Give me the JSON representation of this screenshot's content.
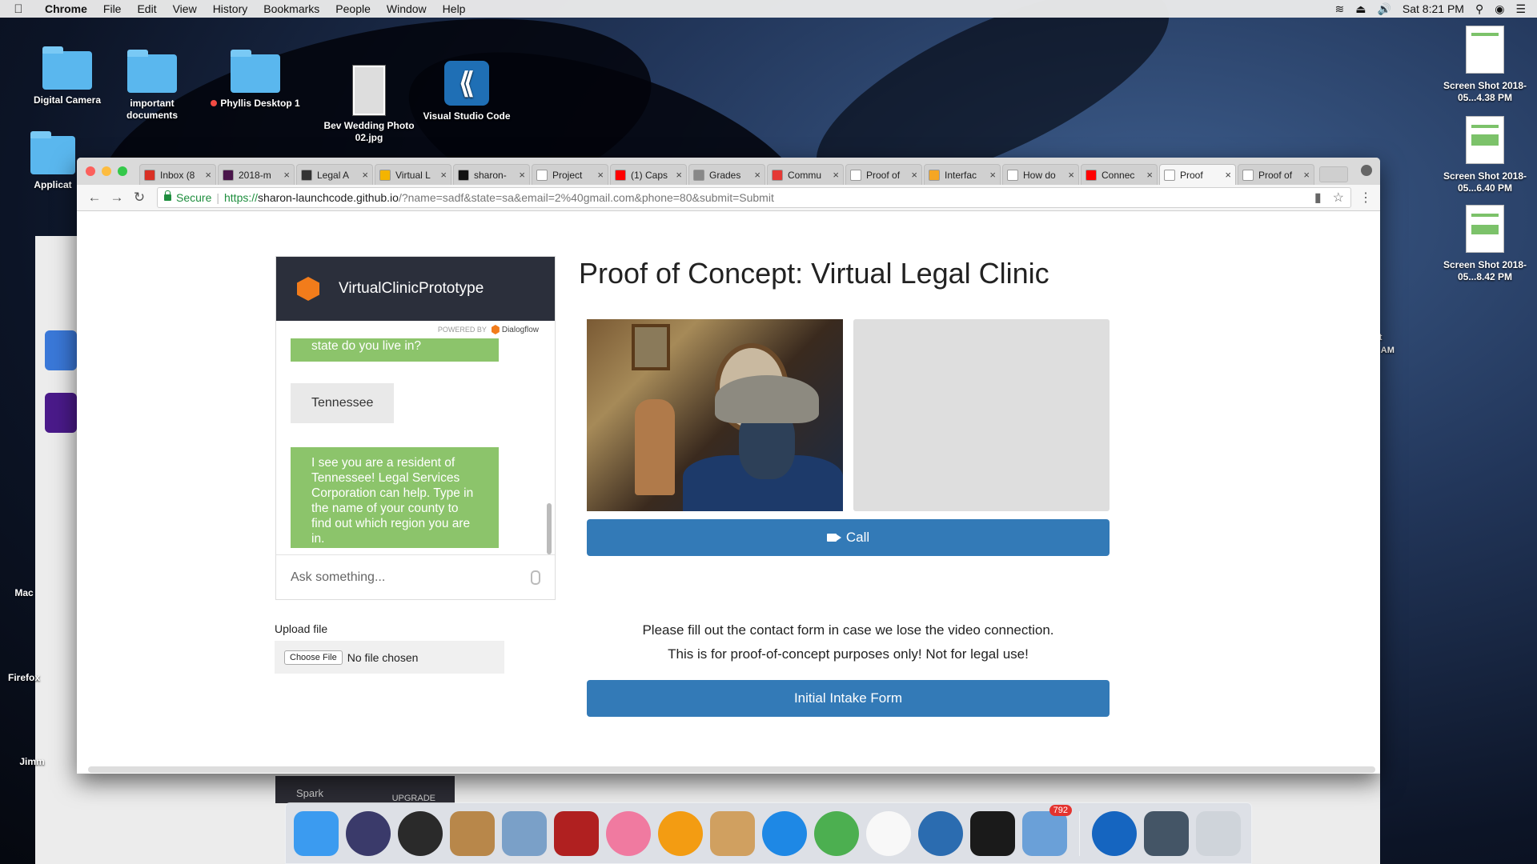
{
  "menubar": {
    "items": [
      "Chrome",
      "File",
      "Edit",
      "View",
      "History",
      "Bookmarks",
      "People",
      "Window",
      "Help"
    ],
    "clock": "Sat 8:21 PM"
  },
  "desktop": {
    "icons": [
      {
        "label": "Digital Camera"
      },
      {
        "label": "important documents"
      },
      {
        "label": "Phyllis Desktop 1"
      },
      {
        "label": "Bev Wedding Photo 02.jpg"
      },
      {
        "label": "Visual Studio Code"
      },
      {
        "label": "Applicat"
      }
    ],
    "screenshots": [
      {
        "label": "Screen Shot 2018-05...4.38 PM"
      },
      {
        "label": "Screen Shot 2018-05...6.40 PM"
      },
      {
        "label": "Screen Shot 2018-05...8.42 PM"
      }
    ],
    "left_labels": [
      "Mac",
      "Firefox",
      "Jimm"
    ],
    "edge_text": [
      "ot",
      "7 AM"
    ]
  },
  "browser": {
    "tabs": [
      {
        "title": "Inbox (8",
        "color": "#d93025"
      },
      {
        "title": "2018-m",
        "color": "#4a154b"
      },
      {
        "title": "Legal A",
        "color": "#333333"
      },
      {
        "title": "Virtual L",
        "color": "#f4b400"
      },
      {
        "title": "sharon-",
        "color": "#111111"
      },
      {
        "title": "Project",
        "color": "#ffffff"
      },
      {
        "title": "(1) Caps",
        "color": "#ff0000"
      },
      {
        "title": "Grades",
        "color": "#888888"
      },
      {
        "title": "Commu",
        "color": "#e53935"
      },
      {
        "title": "Proof of",
        "color": "#ffffff"
      },
      {
        "title": "Interfac",
        "color": "#f5a623"
      },
      {
        "title": "How do",
        "color": "#ffffff"
      },
      {
        "title": "Connec",
        "color": "#ff0000"
      },
      {
        "title": "Proof",
        "color": "#ffffff"
      },
      {
        "title": "Proof of",
        "color": "#ffffff"
      }
    ],
    "active_tab_index": 13,
    "address": {
      "secure_label": "Secure",
      "scheme": "https://",
      "host": "sharon-launchcode.github.io",
      "path": "/?name=sadf&state=sa&email=2%40gmail.com&phone=80&submit=Submit"
    }
  },
  "chat": {
    "bot_name": "VirtualClinicPrototype",
    "powered_by": "POWERED BY",
    "brand": "Dialogflow",
    "messages": [
      {
        "from": "bot",
        "text": "state do you live in?"
      },
      {
        "from": "user",
        "text": "Tennessee"
      },
      {
        "from": "bot",
        "text": "I see you are a resident of Tennessee! Legal Services Corporation can help. Type in the name of your county to find out which region you are in."
      }
    ],
    "input_placeholder": "Ask something..."
  },
  "page": {
    "title": "Proof of Concept: Virtual Legal Clinic",
    "call_button": "Call",
    "upload_label": "Upload file",
    "choose_file": "Choose File",
    "no_file": "No file chosen",
    "notice_line1": "Please fill out the contact form in case we lose the video connection.",
    "notice_line2": "This is for proof-of-concept purposes only! Not for legal use!",
    "intake_button": "Initial Intake Form"
  },
  "spark": {
    "name": "Spark",
    "upgrade": "UPGRADE"
  },
  "dock": {
    "apps": [
      {
        "name": "Finder",
        "color": "#3b9bf0"
      },
      {
        "name": "Siri",
        "color": "#3a3a6a"
      },
      {
        "name": "Launchpad",
        "color": "#2a2a2a"
      },
      {
        "name": "Contacts",
        "color": "#b8874a"
      },
      {
        "name": "Preview",
        "color": "#7aa0c8"
      },
      {
        "name": "Photo Booth",
        "color": "#b02020"
      },
      {
        "name": "iTunes",
        "color": "#f07aa0"
      },
      {
        "name": "iBooks",
        "color": "#f39c12"
      },
      {
        "name": "Keynote",
        "color": "#d0a060"
      },
      {
        "name": "Safari",
        "color": "#1e88e5"
      },
      {
        "name": "Chrome",
        "color": "#4caf50"
      },
      {
        "name": "Photos",
        "color": "#f8f8f8"
      },
      {
        "name": "Network Utility",
        "color": "#2b6cb0"
      },
      {
        "name": "Terminal",
        "color": "#1a1a1a"
      },
      {
        "name": "Mail",
        "color": "#6aa0d8",
        "badge": "792"
      },
      {
        "name": "Globe",
        "color": "#1565c0"
      },
      {
        "name": "Images",
        "color": "#445566"
      },
      {
        "name": "Trash",
        "color": "#cfd4da"
      }
    ]
  }
}
